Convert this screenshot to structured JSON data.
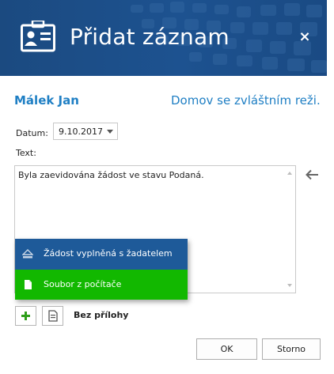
{
  "header": {
    "title": "Přidat záznam",
    "icon": "id-badge-icon",
    "close_icon": "close-icon",
    "close_label": "×",
    "color": "#1c4e86"
  },
  "record": {
    "person_name": "Málek Jan",
    "facility": "Domov se zvláštním reži..."
  },
  "form": {
    "date_label": "Datum:",
    "date_value": "9.10.2017",
    "text_label": "Text:",
    "text_value": "Byla zaevidována žádost ve stavu Podaná."
  },
  "popup_menu": {
    "items": [
      {
        "label": "Žádost  vyplněná s žadatelem",
        "icon": "eject-icon",
        "color": "#1e5a99"
      },
      {
        "label": "Soubor z počítače",
        "icon": "document-icon",
        "color": "#12b800"
      }
    ]
  },
  "attachments": {
    "add_icon": "plus-icon",
    "note_icon": "note-icon",
    "status": "Bez přílohy"
  },
  "actions": {
    "ok_label": "OK",
    "cancel_label": "Storno"
  },
  "colors": {
    "accent_text": "#1f7fc4"
  }
}
